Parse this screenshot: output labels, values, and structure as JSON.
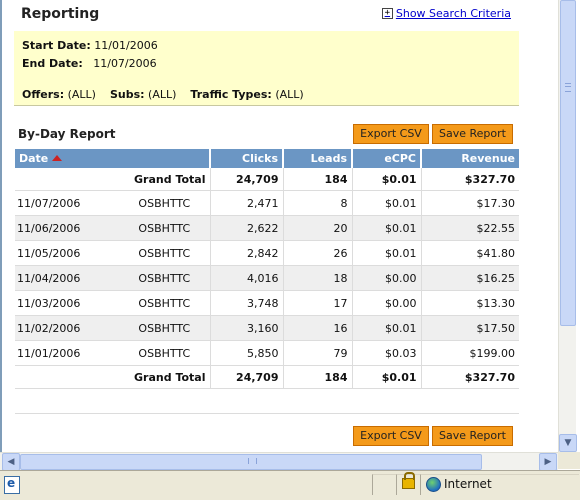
{
  "page": {
    "title": "Reporting",
    "search_link": "Show Search Criteria",
    "search_toggle": "+"
  },
  "criteria": {
    "start_label": "Start Date:",
    "start_value": "11/01/2006",
    "end_label": "End Date:",
    "end_value": "11/07/2006",
    "offers_label": "Offers:",
    "offers_value": "(ALL)",
    "subs_label": "Subs:",
    "subs_value": "(ALL)",
    "traffic_label": "Traffic Types:",
    "traffic_value": "(ALL)"
  },
  "report": {
    "section_title": "By-Day Report",
    "export_csv": "Export CSV",
    "save_report": "Save Report",
    "columns": [
      "Date",
      "Clicks",
      "Leads",
      "eCPC",
      "Revenue"
    ],
    "grand_total": {
      "label": "Grand Total",
      "clicks": "24,709",
      "leads": "184",
      "ecpc": "$0.01",
      "revenue": "$327.70"
    },
    "link_labels": [
      "O",
      "S",
      "BH",
      "TT",
      "C"
    ],
    "rows": [
      {
        "date": "11/07/2006",
        "clicks": "2,471",
        "leads": "8",
        "ecpc": "$0.01",
        "revenue": "$17.30"
      },
      {
        "date": "11/06/2006",
        "clicks": "2,622",
        "leads": "20",
        "ecpc": "$0.01",
        "revenue": "$22.55"
      },
      {
        "date": "11/05/2006",
        "clicks": "2,842",
        "leads": "26",
        "ecpc": "$0.01",
        "revenue": "$41.80"
      },
      {
        "date": "11/04/2006",
        "clicks": "4,016",
        "leads": "18",
        "ecpc": "$0.00",
        "revenue": "$16.25"
      },
      {
        "date": "11/03/2006",
        "clicks": "3,748",
        "leads": "17",
        "ecpc": "$0.00",
        "revenue": "$13.30"
      },
      {
        "date": "11/02/2006",
        "clicks": "3,160",
        "leads": "16",
        "ecpc": "$0.01",
        "revenue": "$17.50"
      },
      {
        "date": "11/01/2006",
        "clicks": "5,850",
        "leads": "79",
        "ecpc": "$0.03",
        "revenue": "$199.00"
      }
    ]
  },
  "status_bar": {
    "zone": "Internet"
  },
  "icons": {
    "sort": "sort-ascending-icon",
    "lock": "padlock-icon",
    "zone": "globe-icon",
    "page": "ie-page-icon"
  },
  "colors": {
    "header_bg": "#6b96c4",
    "criteria_bg": "#ffffcc",
    "button_bg": "#f49a1a",
    "link": "#0000cc"
  }
}
